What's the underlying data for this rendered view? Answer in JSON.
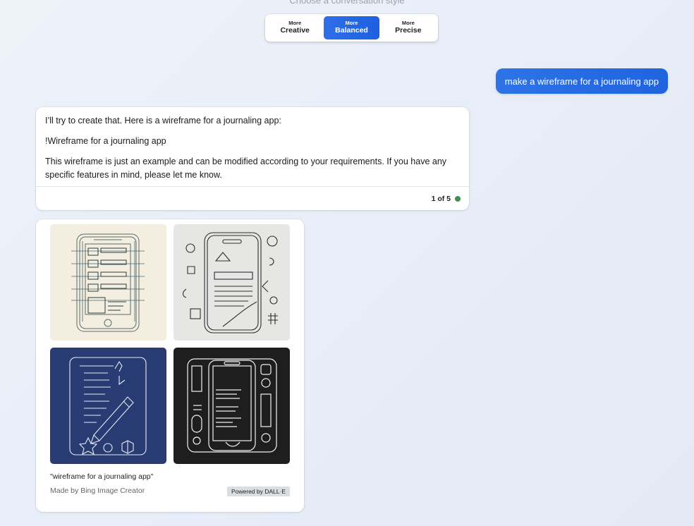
{
  "header": {
    "style_prompt": "Choose a conversation style"
  },
  "style_options": [
    {
      "small": "More",
      "big": "Creative"
    },
    {
      "small": "More",
      "big": "Balanced"
    },
    {
      "small": "More",
      "big": "Precise"
    }
  ],
  "user_message": "make a wireframe for a journaling app",
  "bot_message": {
    "paragraphs": [
      "I’ll try to create that. Here is a wireframe for a journaling app:",
      "!Wireframe for a journaling app",
      "This wireframe is just an example and can be modified according to your requirements. If you have any specific features in mind, please let me know."
    ],
    "counter": "1 of 5",
    "status_color": "#3f8f4e"
  },
  "image_card": {
    "caption": "\"wireframe for a journaling app\"",
    "made_by": "Made by Bing Image Creator",
    "powered_by": "Powered by DALL·E",
    "thumbnails": [
      {
        "style": "cream sketch",
        "bg": "#f3eedf"
      },
      {
        "style": "grey sketch",
        "bg": "#e6e6e4"
      },
      {
        "style": "blueprint",
        "bg": "#283b72"
      },
      {
        "style": "dark line art",
        "bg": "#1e1e1e"
      }
    ]
  },
  "colors": {
    "accent": "#1f63df",
    "page_bg": "#e9eef8"
  }
}
